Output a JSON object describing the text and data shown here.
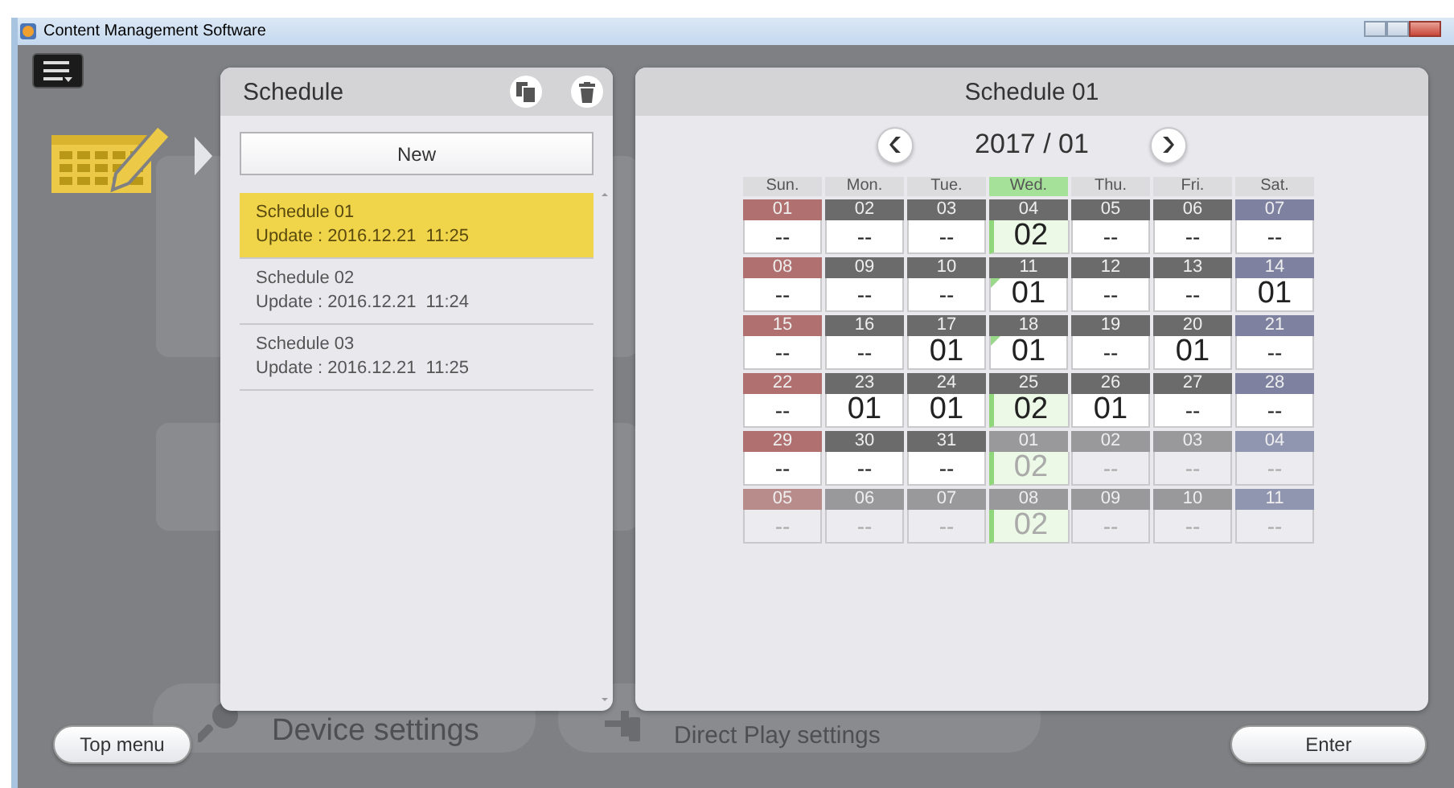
{
  "window": {
    "title": "Content Management Software"
  },
  "background": {
    "buttons": [
      {
        "label": "Device settings",
        "kind": "search"
      },
      {
        "label": "Direct Play settings",
        "kind": "device"
      }
    ]
  },
  "schedule_list": {
    "title": "Schedule",
    "new_button": "New",
    "items": [
      {
        "name": "Schedule 01",
        "update": "Update : 2016.12.21  11:25",
        "selected": true
      },
      {
        "name": "Schedule 02",
        "update": "Update : 2016.12.21  11:24",
        "selected": false
      },
      {
        "name": "Schedule 03",
        "update": "Update : 2016.12.21  11:25",
        "selected": false
      }
    ]
  },
  "calendar": {
    "title": "Schedule 01",
    "month": "2017 / 01",
    "weekdays": [
      {
        "label": "Sun.",
        "kind": "sunday",
        "selected": false
      },
      {
        "label": "Mon.",
        "kind": "weekday",
        "selected": false
      },
      {
        "label": "Tue.",
        "kind": "weekday",
        "selected": false
      },
      {
        "label": "Wed.",
        "kind": "weekday",
        "selected": true
      },
      {
        "label": "Thu.",
        "kind": "weekday",
        "selected": false
      },
      {
        "label": "Fri.",
        "kind": "weekday",
        "selected": false
      },
      {
        "label": "Sat.",
        "kind": "saturday",
        "selected": false
      }
    ],
    "weeks": [
      [
        {
          "day": "01",
          "value": "--",
          "in_month": true,
          "highlight": false,
          "flag": false
        },
        {
          "day": "02",
          "value": "--",
          "in_month": true,
          "highlight": false,
          "flag": false
        },
        {
          "day": "03",
          "value": "--",
          "in_month": true,
          "highlight": false,
          "flag": false
        },
        {
          "day": "04",
          "value": "02",
          "in_month": true,
          "highlight": true,
          "flag": false
        },
        {
          "day": "05",
          "value": "--",
          "in_month": true,
          "highlight": false,
          "flag": false
        },
        {
          "day": "06",
          "value": "--",
          "in_month": true,
          "highlight": false,
          "flag": false
        },
        {
          "day": "07",
          "value": "--",
          "in_month": true,
          "highlight": false,
          "flag": false
        }
      ],
      [
        {
          "day": "08",
          "value": "--",
          "in_month": true,
          "highlight": false,
          "flag": false
        },
        {
          "day": "09",
          "value": "--",
          "in_month": true,
          "highlight": false,
          "flag": false
        },
        {
          "day": "10",
          "value": "--",
          "in_month": true,
          "highlight": false,
          "flag": false
        },
        {
          "day": "11",
          "value": "01",
          "in_month": true,
          "highlight": false,
          "flag": true
        },
        {
          "day": "12",
          "value": "--",
          "in_month": true,
          "highlight": false,
          "flag": false
        },
        {
          "day": "13",
          "value": "--",
          "in_month": true,
          "highlight": false,
          "flag": false
        },
        {
          "day": "14",
          "value": "01",
          "in_month": true,
          "highlight": false,
          "flag": false
        }
      ],
      [
        {
          "day": "15",
          "value": "--",
          "in_month": true,
          "highlight": false,
          "flag": false
        },
        {
          "day": "16",
          "value": "--",
          "in_month": true,
          "highlight": false,
          "flag": false
        },
        {
          "day": "17",
          "value": "01",
          "in_month": true,
          "highlight": false,
          "flag": false
        },
        {
          "day": "18",
          "value": "01",
          "in_month": true,
          "highlight": false,
          "flag": true
        },
        {
          "day": "19",
          "value": "--",
          "in_month": true,
          "highlight": false,
          "flag": false
        },
        {
          "day": "20",
          "value": "01",
          "in_month": true,
          "highlight": false,
          "flag": false
        },
        {
          "day": "21",
          "value": "--",
          "in_month": true,
          "highlight": false,
          "flag": false
        }
      ],
      [
        {
          "day": "22",
          "value": "--",
          "in_month": true,
          "highlight": false,
          "flag": false
        },
        {
          "day": "23",
          "value": "01",
          "in_month": true,
          "highlight": false,
          "flag": false
        },
        {
          "day": "24",
          "value": "01",
          "in_month": true,
          "highlight": false,
          "flag": false
        },
        {
          "day": "25",
          "value": "02",
          "in_month": true,
          "highlight": true,
          "flag": false
        },
        {
          "day": "26",
          "value": "01",
          "in_month": true,
          "highlight": false,
          "flag": false
        },
        {
          "day": "27",
          "value": "--",
          "in_month": true,
          "highlight": false,
          "flag": false
        },
        {
          "day": "28",
          "value": "--",
          "in_month": true,
          "highlight": false,
          "flag": false
        }
      ],
      [
        {
          "day": "29",
          "value": "--",
          "in_month": true,
          "highlight": false,
          "flag": false
        },
        {
          "day": "30",
          "value": "--",
          "in_month": true,
          "highlight": false,
          "flag": false
        },
        {
          "day": "31",
          "value": "--",
          "in_month": true,
          "highlight": false,
          "flag": false
        },
        {
          "day": "01",
          "value": "02",
          "in_month": false,
          "highlight": true,
          "flag": false
        },
        {
          "day": "02",
          "value": "--",
          "in_month": false,
          "highlight": false,
          "flag": false
        },
        {
          "day": "03",
          "value": "--",
          "in_month": false,
          "highlight": false,
          "flag": false
        },
        {
          "day": "04",
          "value": "--",
          "in_month": false,
          "highlight": false,
          "flag": false
        }
      ],
      [
        {
          "day": "05",
          "value": "--",
          "in_month": false,
          "highlight": false,
          "flag": false
        },
        {
          "day": "06",
          "value": "--",
          "in_month": false,
          "highlight": false,
          "flag": false
        },
        {
          "day": "07",
          "value": "--",
          "in_month": false,
          "highlight": false,
          "flag": false
        },
        {
          "day": "08",
          "value": "02",
          "in_month": false,
          "highlight": true,
          "flag": false
        },
        {
          "day": "09",
          "value": "--",
          "in_month": false,
          "highlight": false,
          "flag": false
        },
        {
          "day": "10",
          "value": "--",
          "in_month": false,
          "highlight": false,
          "flag": false
        },
        {
          "day": "11",
          "value": "--",
          "in_month": false,
          "highlight": false,
          "flag": false
        }
      ]
    ]
  },
  "footer": {
    "left_button": "Top menu",
    "right_button": "Enter"
  }
}
